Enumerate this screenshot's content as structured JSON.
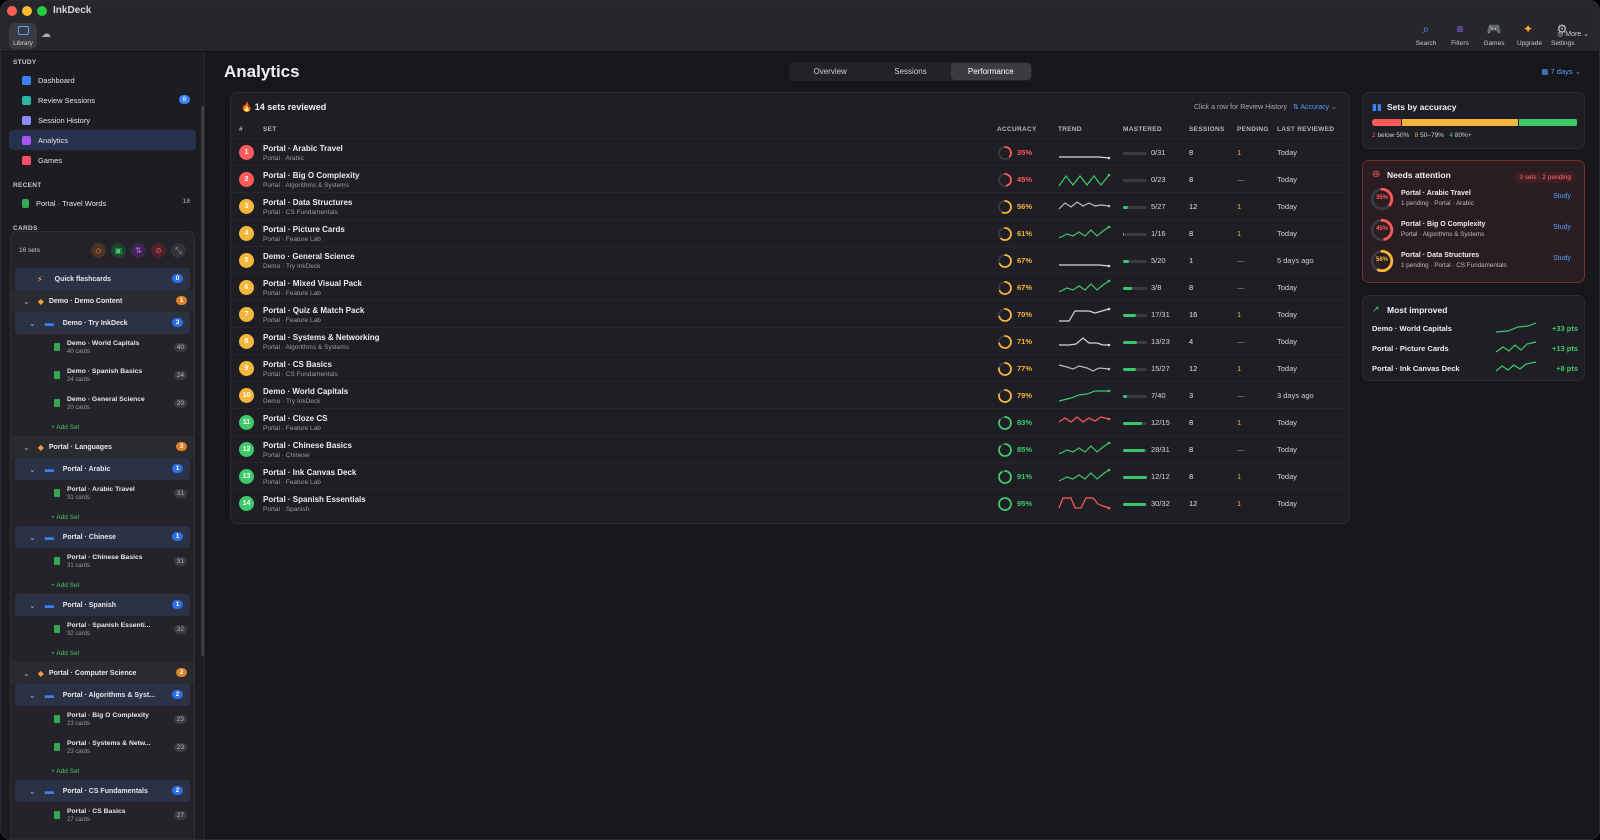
{
  "app": {
    "title": "InkDeck",
    "library_label": "Library"
  },
  "toolbar": {
    "tools": [
      {
        "label": "Search",
        "icon": "search-icon",
        "glyph": "⌕",
        "color": "#5b9cff"
      },
      {
        "label": "Filters",
        "icon": "filter-icon",
        "glyph": "≡",
        "color": "#a46bff"
      },
      {
        "label": "Games",
        "icon": "gamepad-icon",
        "glyph": "🎮",
        "color": "#ff4d6d"
      },
      {
        "label": "Upgrade",
        "icon": "sparkle-icon",
        "glyph": "✦",
        "color": "#ffb02e"
      },
      {
        "label": "Settings",
        "icon": "gear-icon",
        "glyph": "⚙",
        "color": "#c9c9cf"
      }
    ],
    "more_label": "More"
  },
  "sidebar": {
    "study_title": "STUDY",
    "study_items": [
      {
        "label": "Dashboard",
        "color": "#3b82f6",
        "badge": ""
      },
      {
        "label": "Review Sessions",
        "color": "#2bb3a3",
        "badge": "8"
      },
      {
        "label": "Session History",
        "color": "#8b8bff",
        "badge": ""
      },
      {
        "label": "Analytics",
        "color": "#a855f7",
        "badge": ""
      },
      {
        "label": "Games",
        "color": "#ff4d6d",
        "badge": ""
      }
    ],
    "recent_title": "RECENT",
    "recent": {
      "label": "Portal · Travel Words",
      "count": "18"
    },
    "cards_title": "CARDS",
    "sets_count": "16 sets",
    "quick": {
      "label": "Quick flashcards",
      "badge": "0"
    },
    "tree": [
      {
        "type": "grp",
        "label": "Demo · Demo Content",
        "badge": "1"
      },
      {
        "type": "sub",
        "label": "Demo · Try InkDeck",
        "badge": "3"
      },
      {
        "type": "leaf",
        "label": "Demo · World Capitals",
        "cards": "40 cards",
        "badge": "40"
      },
      {
        "type": "leaf",
        "label": "Demo · Spanish Basics",
        "cards": "24 cards",
        "badge": "24"
      },
      {
        "type": "leaf",
        "label": "Demo · General Science",
        "cards": "20 cards",
        "badge": "20"
      },
      {
        "type": "add",
        "label": "+ Add Set"
      },
      {
        "type": "grp",
        "label": "Portal · Languages",
        "badge": "3"
      },
      {
        "type": "sub",
        "label": "Portal · Arabic",
        "badge": "1"
      },
      {
        "type": "leaf",
        "label": "Portal · Arabic Travel",
        "cards": "31 cards",
        "badge": "31"
      },
      {
        "type": "add",
        "label": "+ Add Set"
      },
      {
        "type": "sub",
        "label": "Portal · Chinese",
        "badge": "1"
      },
      {
        "type": "leaf",
        "label": "Portal · Chinese Basics",
        "cards": "31 cards",
        "badge": "31"
      },
      {
        "type": "add",
        "label": "+ Add Set"
      },
      {
        "type": "sub",
        "label": "Portal · Spanish",
        "badge": "1"
      },
      {
        "type": "leaf",
        "label": "Portal · Spanish Essenti...",
        "cards": "32 cards",
        "badge": "32"
      },
      {
        "type": "add",
        "label": "+ Add Set"
      },
      {
        "type": "grp",
        "label": "Portal · Computer Science",
        "badge": "2"
      },
      {
        "type": "sub",
        "label": "Portal · Algorithms & Syst...",
        "badge": "2"
      },
      {
        "type": "leaf",
        "label": "Portal · Big O Complexity",
        "cards": "23 cards",
        "badge": "23"
      },
      {
        "type": "leaf",
        "label": "Portal · Systems & Netw...",
        "cards": "23 cards",
        "badge": "23"
      },
      {
        "type": "add",
        "label": "+ Add Set"
      },
      {
        "type": "sub",
        "label": "Portal · CS Fundamentals",
        "badge": "2"
      },
      {
        "type": "leaf",
        "label": "Portal · CS Basics",
        "cards": "27 cards",
        "badge": "27"
      }
    ]
  },
  "main": {
    "title": "Analytics",
    "tabs": [
      "Overview",
      "Sessions",
      "Performance"
    ],
    "active_tab": "Performance",
    "range": "7 days"
  },
  "table": {
    "title": "14 sets reviewed",
    "hint": "Click a row for Review History",
    "sort": "Accuracy",
    "headers": [
      "#",
      "SET",
      "ACCURACY",
      "TREND",
      "MASTERED",
      "SESSIONS",
      "PENDING",
      "LAST REVIEWED"
    ],
    "rows": [
      {
        "n": "1",
        "name": "Portal · Arabic Travel",
        "sub": "Portal · Arabic",
        "acc": 35,
        "trend": "flat",
        "mastered": "0/31",
        "m": 0,
        "sessions": "8",
        "pending": "1",
        "last": "Today"
      },
      {
        "n": "2",
        "name": "Portal · Big O Complexity",
        "sub": "Portal · Algorithms & Systems",
        "acc": 45,
        "trend": "wave",
        "mastered": "0/23",
        "m": 0,
        "sessions": "8",
        "pending": "—",
        "last": "Today"
      },
      {
        "n": "3",
        "name": "Portal · Data Structures",
        "sub": "Portal · CS Fundamentals",
        "acc": 56,
        "trend": "zig",
        "mastered": "5/27",
        "m": 0.19,
        "sessions": "12",
        "pending": "1",
        "last": "Today"
      },
      {
        "n": "4",
        "name": "Portal · Picture Cards",
        "sub": "Portal · Feature Lab",
        "acc": 61,
        "trend": "up",
        "mastered": "1/16",
        "m": 0.06,
        "sessions": "8",
        "pending": "1",
        "last": "Today"
      },
      {
        "n": "5",
        "name": "Demo · General Science",
        "sub": "Demo · Try InkDeck",
        "acc": 67,
        "trend": "flat",
        "mastered": "5/20",
        "m": 0.25,
        "sessions": "1",
        "pending": "—",
        "last": "5 days ago"
      },
      {
        "n": "6",
        "name": "Portal · Mixed Visual Pack",
        "sub": "Portal · Feature Lab",
        "acc": 67,
        "trend": "up",
        "mastered": "3/8",
        "m": 0.38,
        "sessions": "8",
        "pending": "—",
        "last": "Today"
      },
      {
        "n": "7",
        "name": "Portal · Quiz & Match Pack",
        "sub": "Portal · Feature Lab",
        "acc": 70,
        "trend": "step",
        "mastered": "17/31",
        "m": 0.55,
        "sessions": "16",
        "pending": "1",
        "last": "Today"
      },
      {
        "n": "8",
        "name": "Portal · Systems & Networking",
        "sub": "Portal · Algorithms & Systems",
        "acc": 71,
        "trend": "bump",
        "mastered": "13/23",
        "m": 0.57,
        "sessions": "4",
        "pending": "—",
        "last": "Today"
      },
      {
        "n": "9",
        "name": "Portal · CS Basics",
        "sub": "Portal · CS Fundamentals",
        "acc": 77,
        "trend": "down",
        "mastered": "15/27",
        "m": 0.56,
        "sessions": "12",
        "pending": "1",
        "last": "Today"
      },
      {
        "n": "10",
        "name": "Demo · World Capitals",
        "sub": "Demo · Try InkDeck",
        "acc": 79,
        "trend": "rise",
        "mastered": "7/40",
        "m": 0.18,
        "sessions": "3",
        "pending": "—",
        "last": "3 days ago"
      },
      {
        "n": "11",
        "name": "Portal · Cloze CS",
        "sub": "Portal · Feature Lab",
        "acc": 83,
        "trend": "redzig",
        "mastered": "12/15",
        "m": 0.8,
        "sessions": "8",
        "pending": "1",
        "last": "Today"
      },
      {
        "n": "12",
        "name": "Portal · Chinese Basics",
        "sub": "Portal · Chinese",
        "acc": 85,
        "trend": "up",
        "mastered": "28/31",
        "m": 0.9,
        "sessions": "8",
        "pending": "—",
        "last": "Today"
      },
      {
        "n": "13",
        "name": "Portal · Ink Canvas Deck",
        "sub": "Portal · Feature Lab",
        "acc": 91,
        "trend": "up",
        "mastered": "12/12",
        "m": 1.0,
        "sessions": "8",
        "pending": "1",
        "last": "Today"
      },
      {
        "n": "14",
        "name": "Portal · Spanish Essentials",
        "sub": "Portal · Spanish",
        "acc": 95,
        "trend": "redbox",
        "mastered": "30/32",
        "m": 0.94,
        "sessions": "12",
        "pending": "1",
        "last": "Today"
      }
    ]
  },
  "accuracy_card": {
    "title": "Sets by accuracy",
    "below_count": "2",
    "below_label": "below 50%",
    "mid_count": "8",
    "mid_label": "50–79%",
    "high_count": "4",
    "high_label": "80%+"
  },
  "attention": {
    "title": "Needs attention",
    "pill": "3 sets · 2 pending",
    "items": [
      {
        "pct": "35%",
        "acc": 35,
        "name": "Portal · Arabic Travel",
        "detail": "1 pending · Portal · Arabic",
        "action": "Study"
      },
      {
        "pct": "45%",
        "acc": 45,
        "name": "Portal · Big O Complexity",
        "detail": "Portal · Algorithms & Systems",
        "action": "Study"
      },
      {
        "pct": "56%",
        "acc": 56,
        "name": "Portal · Data Structures",
        "detail": "1 pending · Portal · CS Fundamentals",
        "action": "Study"
      }
    ]
  },
  "improved": {
    "title": "Most improved",
    "items": [
      {
        "name": "Demo · World Capitals",
        "gain": "+33 pts"
      },
      {
        "name": "Portal · Picture Cards",
        "gain": "+13 pts"
      },
      {
        "name": "Portal · Ink Canvas Deck",
        "gain": "+8 pts"
      }
    ]
  }
}
